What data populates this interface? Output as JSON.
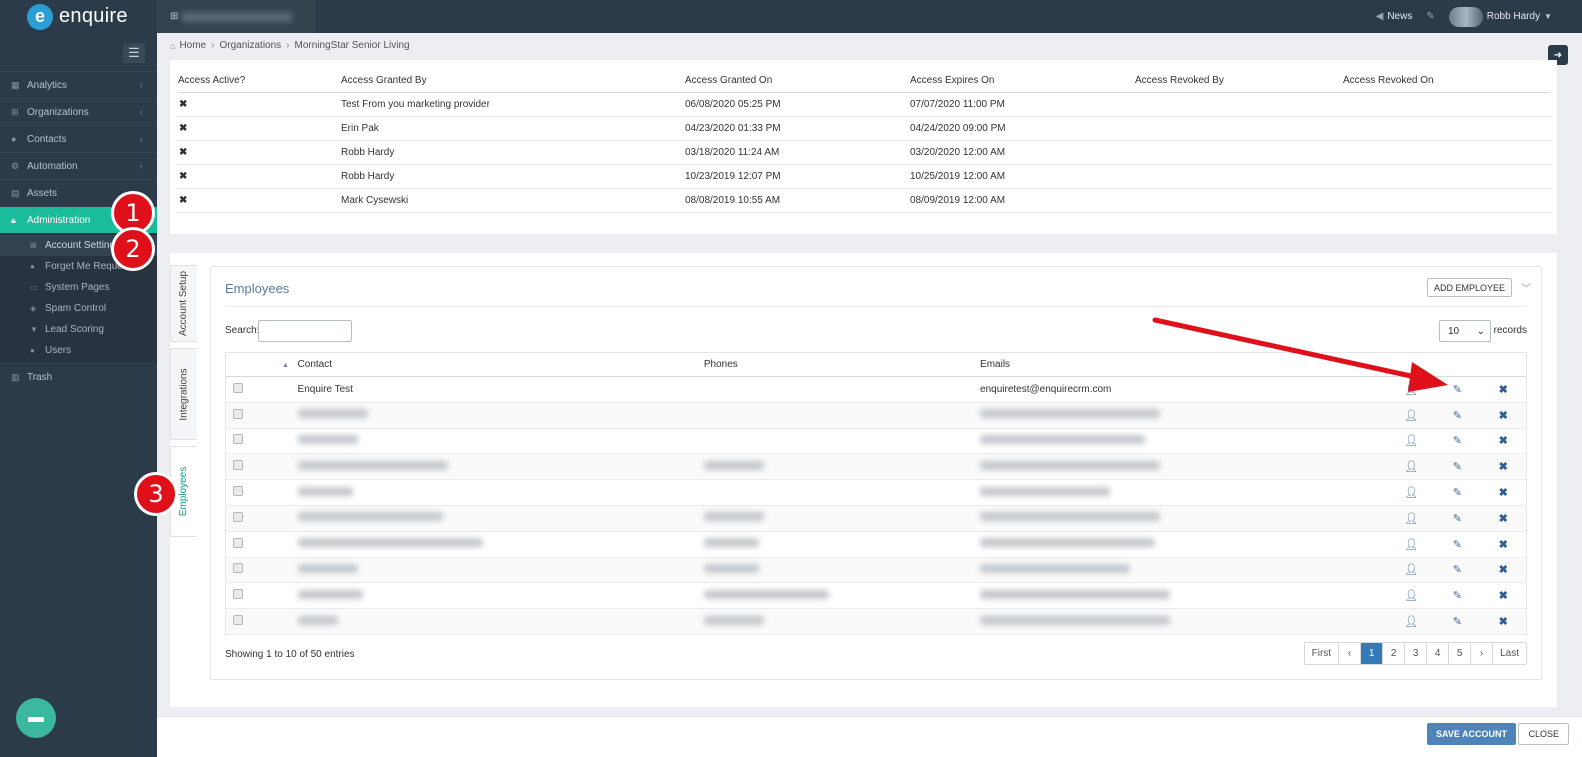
{
  "app": {
    "logo_letter": "e",
    "logo_text": "enquire"
  },
  "topbar": {
    "news_label": "News",
    "user_name": "Robb Hardy"
  },
  "breadcrumb": [
    "Home",
    "Organizations",
    "MorningStar Senior Living"
  ],
  "sidebar": {
    "items": [
      {
        "label": "Analytics",
        "icon": "chart-icon",
        "chevron": "‹"
      },
      {
        "label": "Organizations",
        "icon": "sitemap-icon",
        "chevron": "‹"
      },
      {
        "label": "Contacts",
        "icon": "users-icon",
        "chevron": "‹"
      },
      {
        "label": "Automation",
        "icon": "cogs-icon",
        "chevron": "‹"
      },
      {
        "label": "Assets",
        "icon": "grid-icon",
        "chevron": ""
      },
      {
        "label": "Administration",
        "icon": "lock-icon",
        "chevron": ""
      }
    ],
    "subitems": [
      {
        "label": "Account Settings",
        "icon": "sitemap-icon"
      },
      {
        "label": "Forget Me Requests",
        "icon": "user-minus-icon"
      },
      {
        "label": "System Pages",
        "icon": "card-icon"
      },
      {
        "label": "Spam Control",
        "icon": "shield-icon"
      },
      {
        "label": "Lead Scoring",
        "icon": "filter-icon"
      },
      {
        "label": "Users",
        "icon": "user-icon"
      }
    ],
    "trash_label": "Trash"
  },
  "access": {
    "headers": [
      "Access Active?",
      "Access Granted By",
      "Access Granted On",
      "Access Expires On",
      "Access Revoked By",
      "Access Revoked On"
    ],
    "rows": [
      {
        "granted_by": "Test From you marketing provider",
        "granted_on": "06/08/2020 05:25 PM",
        "expires_on": "07/07/2020 11:00 PM"
      },
      {
        "granted_by": "Erin Pak",
        "granted_on": "04/23/2020 01:33 PM",
        "expires_on": "04/24/2020 09:00 PM"
      },
      {
        "granted_by": "Robb Hardy",
        "granted_on": "03/18/2020 11:24 AM",
        "expires_on": "03/20/2020 12:00 AM"
      },
      {
        "granted_by": "Robb Hardy",
        "granted_on": "10/23/2019 12:07 PM",
        "expires_on": "10/25/2019 12:00 AM"
      },
      {
        "granted_by": "Mark Cysewski",
        "granted_on": "08/08/2019 10:55 AM",
        "expires_on": "08/09/2019 12:00 AM"
      }
    ]
  },
  "vtabs": [
    "Account Setup",
    "Integrations",
    "Employees"
  ],
  "employees": {
    "title": "Employees",
    "add_label": "ADD EMPLOYEE",
    "search_label": "Search:",
    "length_value": "10",
    "records_label": "records",
    "headers": [
      "Contact",
      "Phones",
      "Emails"
    ],
    "first_row": {
      "contact": "Enquire Test",
      "email": "enquiretest@enquirecrm.com"
    },
    "showing": "Showing 1 to 10 of 50 entries",
    "pager": [
      "First",
      "‹",
      "1",
      "2",
      "3",
      "4",
      "5",
      "›",
      "Last"
    ]
  },
  "footer": {
    "save_label": "SAVE ACCOUNT",
    "close_label": "CLOSE"
  },
  "annotations": [
    "1",
    "2",
    "3"
  ],
  "colors": {
    "accent": "#1abc9c",
    "sidebar": "#2c3b4a",
    "annotation": "#e0101a",
    "primary": "#337ab7"
  }
}
